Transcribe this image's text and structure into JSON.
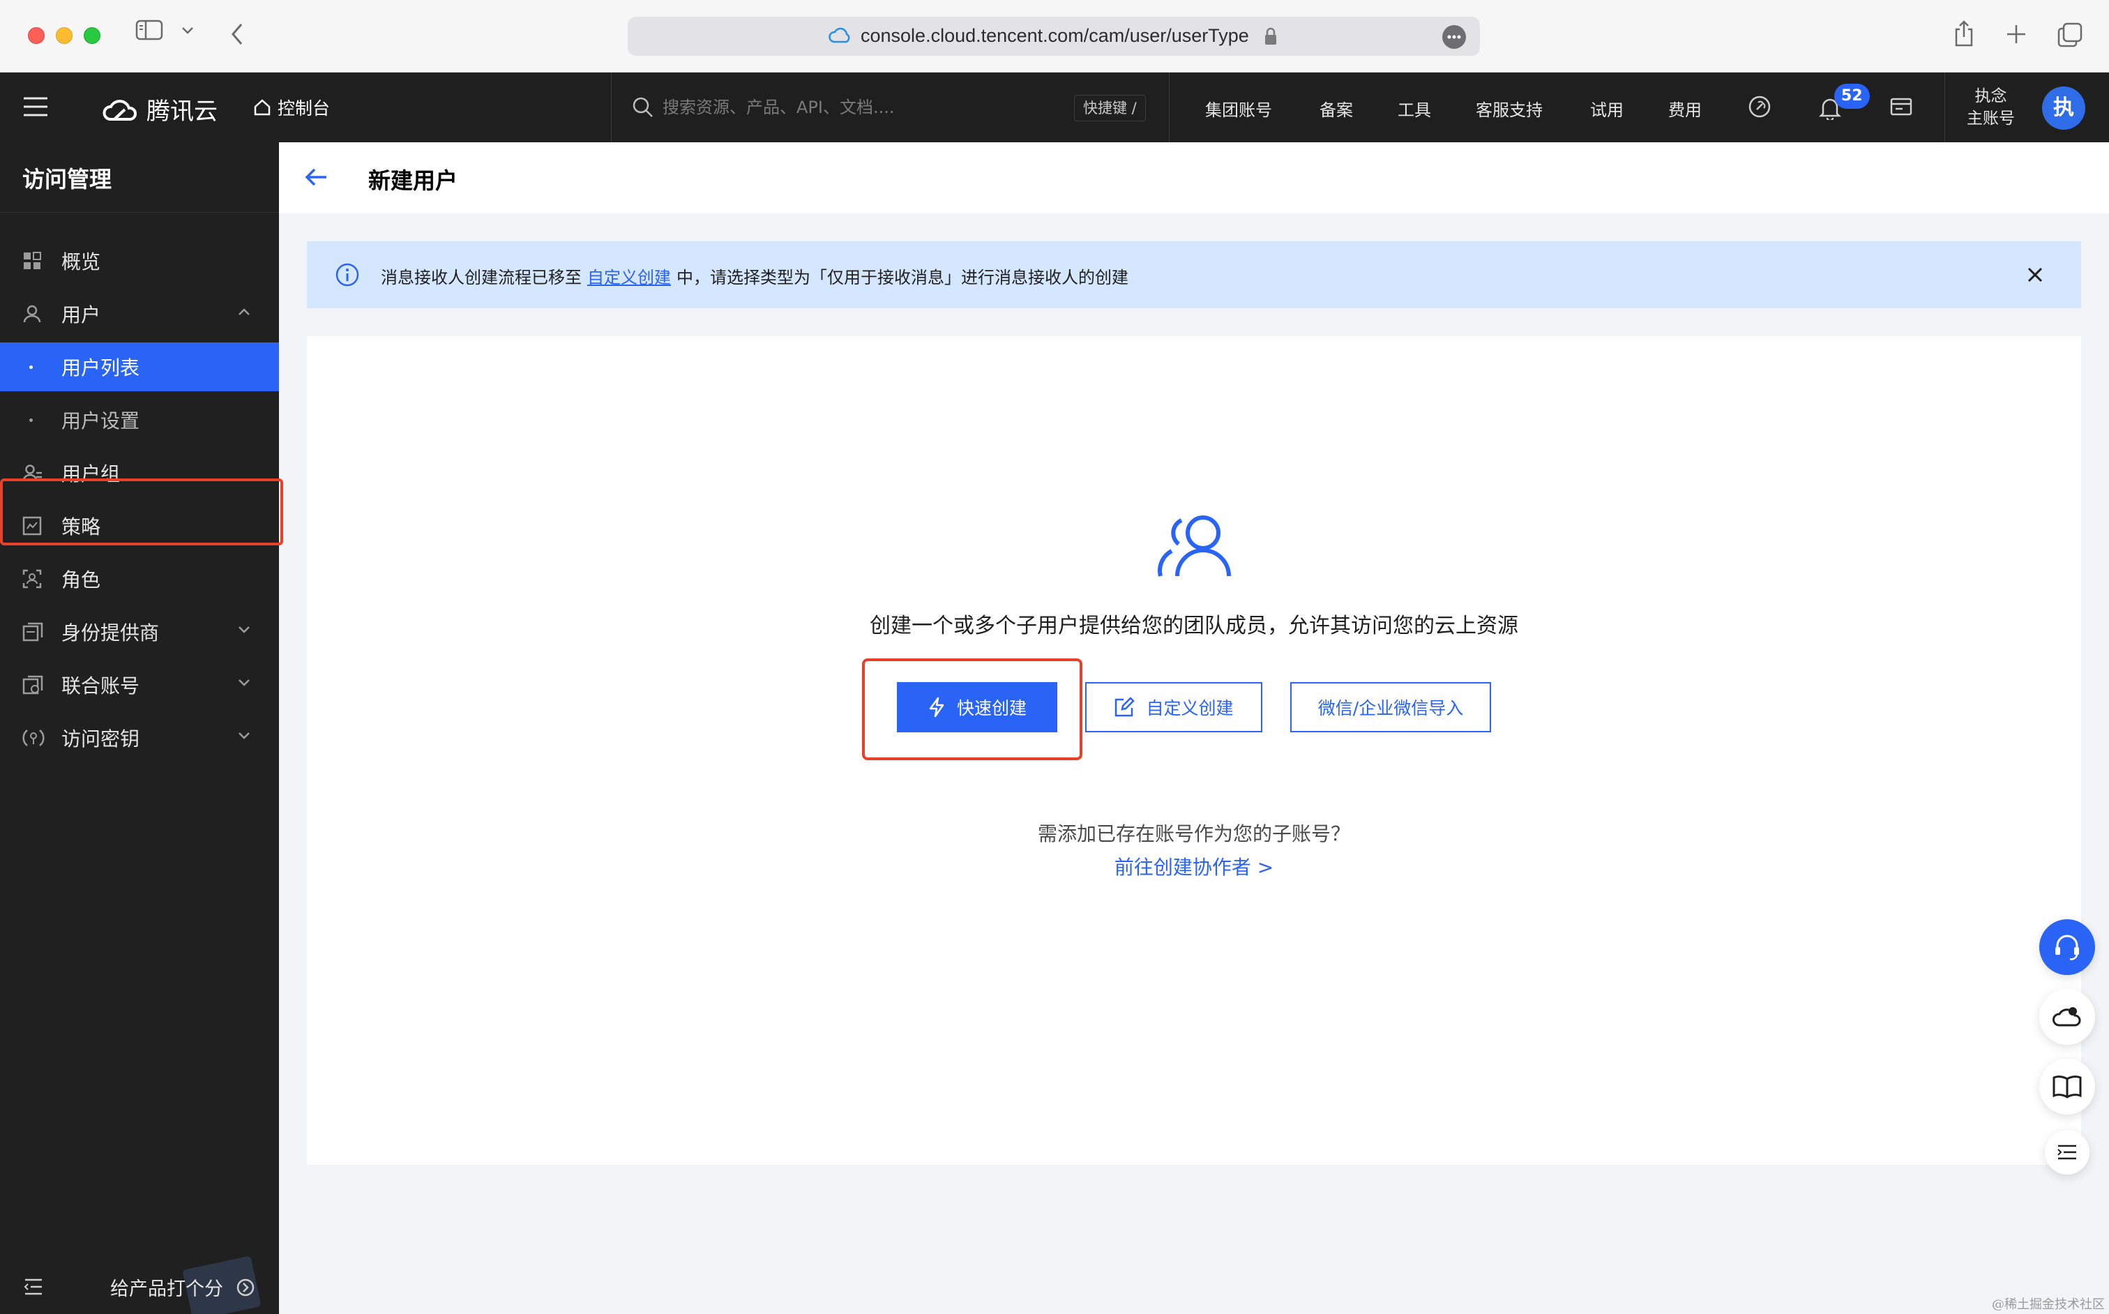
{
  "browser": {
    "url": "console.cloud.tencent.com/cam/user/userType"
  },
  "topnav": {
    "brand": "腾讯云",
    "console_label": "控制台",
    "search_placeholder": "搜索资源、产品、API、文档....",
    "shortcut_label": "快捷键 /",
    "links": [
      "集团账号",
      "备案",
      "工具",
      "客服支持",
      "试用",
      "费用"
    ],
    "notification_count": "52",
    "account_name": "执念",
    "account_role": "主账号",
    "avatar_letter": "执"
  },
  "sidebar": {
    "title": "访问管理",
    "items": [
      {
        "label": "概览",
        "icon": "grid-icon"
      },
      {
        "label": "用户",
        "icon": "user-icon",
        "expanded": true
      },
      {
        "label": "用户列表",
        "sub": true,
        "active": true
      },
      {
        "label": "用户设置",
        "sub": true
      },
      {
        "label": "用户组",
        "icon": "user-group-icon"
      },
      {
        "label": "策略",
        "icon": "policy-icon"
      },
      {
        "label": "角色",
        "icon": "role-icon"
      },
      {
        "label": "身份提供商",
        "icon": "identity-provider-icon",
        "expandable": true
      },
      {
        "label": "联合账号",
        "icon": "federated-account-icon",
        "expandable": true
      },
      {
        "label": "访问密钥",
        "icon": "access-key-icon",
        "expandable": true
      }
    ],
    "rate_label": "给产品打个分"
  },
  "page": {
    "title": "新建用户"
  },
  "notice": {
    "text_before": "消息接收人创建流程已移至",
    "link": "自定义创建",
    "text_after": "中，请选择类型为「仅用于接收消息」进行消息接收人的创建"
  },
  "card": {
    "description": "创建一个或多个子用户提供给您的团队成员，允许其访问您的云上资源",
    "quick_create": "快速创建",
    "custom_create": "自定义创建",
    "wechat_import": "微信/企业微信导入",
    "hint": "需添加已存在账号作为您的子账号？",
    "hint_link": "前往创建协作者 >"
  },
  "watermark": "@稀土掘金技术社区",
  "colors": {
    "accent": "#2a64f6",
    "highlight": "#e8412a",
    "notice_bg": "#d5e7ff",
    "nav_bg": "#1f1f1f"
  }
}
